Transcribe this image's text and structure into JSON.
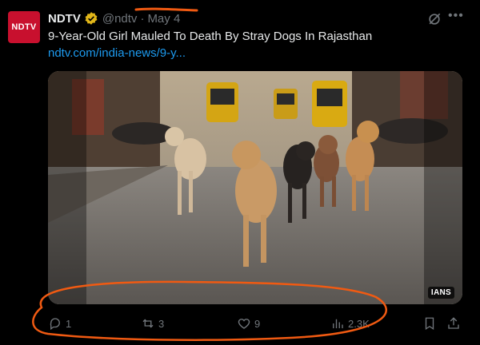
{
  "account": {
    "avatar_text": "NDTV",
    "name": "NDTV",
    "handle": "@ndtv",
    "separator": "·",
    "date": "May 4"
  },
  "tweet": {
    "headline": "9-Year-Old Girl Mauled To Death By Stray Dogs In Rajasthan",
    "link_text": "ndtv.com/india-news/9-y..."
  },
  "media": {
    "credit": "IANS"
  },
  "actions": {
    "replies": "1",
    "reposts": "3",
    "likes": "9",
    "views": "2.3K"
  },
  "colors": {
    "brand": "#c8102e",
    "link": "#1d9bf0",
    "muted": "#71767b",
    "verified_gold": "#e2b719",
    "annotation": "#f05a12"
  },
  "icons": [
    "verified-badge-icon",
    "grok-icon",
    "more-icon",
    "reply-icon",
    "repost-icon",
    "like-icon",
    "views-icon",
    "bookmark-icon",
    "share-icon"
  ]
}
